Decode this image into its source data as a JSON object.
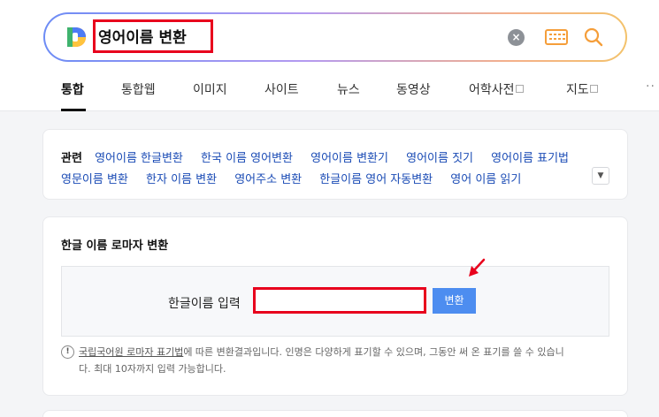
{
  "search": {
    "query": "영어이름 변환"
  },
  "tabs": [
    {
      "label": "통합"
    },
    {
      "label": "통합웹"
    },
    {
      "label": "이미지"
    },
    {
      "label": "사이트"
    },
    {
      "label": "뉴스"
    },
    {
      "label": "동영상"
    },
    {
      "label": "어학사전"
    },
    {
      "label": "지도"
    }
  ],
  "related": {
    "title": "관련",
    "row1": [
      "영어이름 한글변환",
      "한국 이름 영어변환",
      "영어이름 변환기",
      "영어이름 짓기",
      "영어이름 표기법"
    ],
    "row2": [
      "영문이름 변환",
      "한자 이름 변환",
      "영어주소 변환",
      "한글이름 영어 자동변환",
      "영어 이름 읽기"
    ]
  },
  "converter": {
    "title": "한글 이름 로마자 변환",
    "input_label": "한글이름 입력",
    "input_value": "",
    "button_label": "변환",
    "notice_link": "국립국어원 로마자 표기법",
    "notice_text1": "에 따른 변환결과입니다. 인명은 다양하게 표기할 수 있으며, 그동안 써 온 표기를 쓸 수 있습니",
    "notice_text2": "다. 최대 10자까지 입력 가능합니다."
  },
  "colors": {
    "highlight_red": "#e8001c",
    "button_blue": "#4d8df0",
    "link_blue": "#1a4bb5"
  },
  "icons": {
    "clear": "close-circle-icon",
    "keyboard": "keyboard-icon",
    "search": "search-icon",
    "notice": "exclamation-circle-icon",
    "expand": "chevron-down-icon"
  }
}
